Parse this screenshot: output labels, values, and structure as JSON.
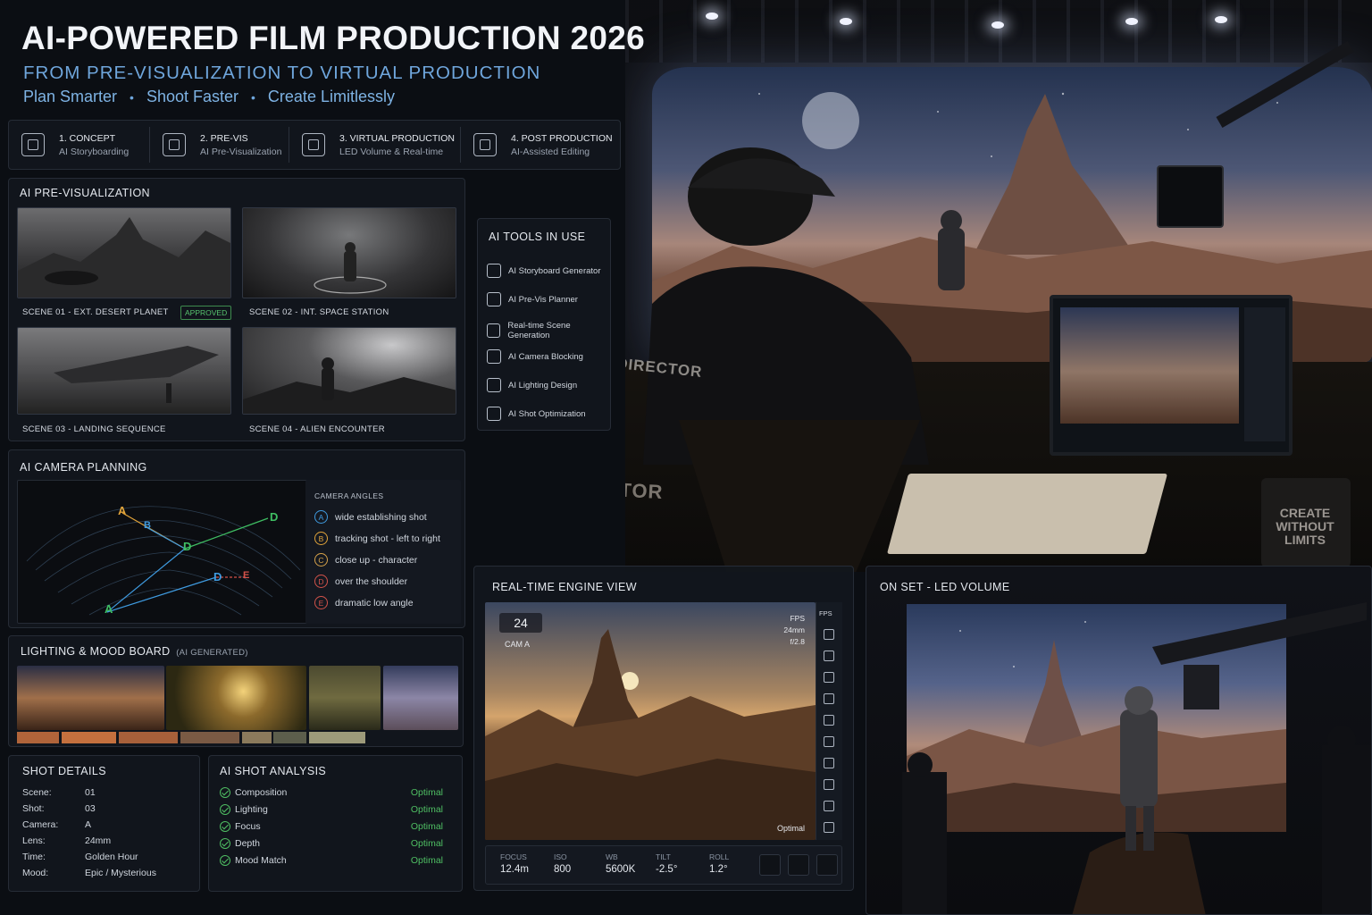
{
  "header": {
    "title": "AI-POWERED FILM PRODUCTION 2026",
    "subtitle": "FROM PRE-VISUALIZATION TO VIRTUAL PRODUCTION",
    "taglines": [
      "Plan Smarter",
      "Shoot Faster",
      "Create Limitlessly"
    ]
  },
  "workflow": [
    {
      "title": "1. CONCEPT",
      "desc": "AI Storyboarding",
      "icon": "storyboard-icon"
    },
    {
      "title": "2. PRE-VIS",
      "desc": "AI Pre-Visualization",
      "icon": "previs-icon"
    },
    {
      "title": "3. VIRTUAL PRODUCTION",
      "desc": "LED Volume & Real-time",
      "icon": "camera-icon"
    },
    {
      "title": "4. POST PRODUCTION",
      "desc": "AI-Assisted Editing",
      "icon": "edit-icon"
    }
  ],
  "previs": {
    "title": "AI PRE-VISUALIZATION",
    "scenes": [
      {
        "label": "SCENE 01 - EXT. DESERT PLANET",
        "status": "APPROVED"
      },
      {
        "label": "SCENE 02 - INT. SPACE STATION"
      },
      {
        "label": "SCENE 03 - LANDING SEQUENCE"
      },
      {
        "label": "SCENE 04 - ALIEN ENCOUNTER"
      }
    ]
  },
  "tools": {
    "title": "AI TOOLS IN USE",
    "items": [
      {
        "label": "AI Storyboard Generator",
        "icon": "storyboard-icon"
      },
      {
        "label": "AI Pre-Vis Planner",
        "icon": "planner-icon"
      },
      {
        "label": "Real-time Scene Generation",
        "icon": "scene-gen-icon"
      },
      {
        "label": "AI Camera Blocking",
        "icon": "camera-blocking-icon"
      },
      {
        "label": "AI Lighting Design",
        "icon": "lightbulb-icon"
      },
      {
        "label": "AI Shot Optimization",
        "icon": "optimize-icon"
      }
    ]
  },
  "camera_planning": {
    "title": "AI CAMERA PLANNING",
    "angles_title": "CAMERA ANGLES",
    "angles": [
      {
        "letter": "A",
        "label": "wide establishing shot",
        "color": "#3f9be0"
      },
      {
        "letter": "B",
        "label": "tracking shot - left to right",
        "color": "#e0a33a"
      },
      {
        "letter": "C",
        "label": "close up - character",
        "color": "#d6a24a"
      },
      {
        "letter": "D",
        "label": "over the shoulder",
        "color": "#d2524a"
      },
      {
        "letter": "E",
        "label": "dramatic low angle",
        "color": "#d2524a"
      }
    ],
    "map_markers": [
      "A",
      "B",
      "D",
      "D",
      "A",
      "D",
      "E"
    ]
  },
  "lighting": {
    "title": "LIGHTING & MOOD BOARD",
    "note": "(AI GENERATED)",
    "swatches": [
      "#b0643a",
      "#c4703e",
      "#a7603a",
      "#7a5a44",
      "#8b7a5c",
      "#5c5e4c",
      "#9d9a7a"
    ]
  },
  "shot_details": {
    "title": "SHOT DETAILS",
    "rows": [
      {
        "key": "Scene:",
        "value": "01"
      },
      {
        "key": "Shot:",
        "value": "03"
      },
      {
        "key": "Camera:",
        "value": "A"
      },
      {
        "key": "Lens:",
        "value": "24mm"
      },
      {
        "key": "Time:",
        "value": "Golden Hour"
      },
      {
        "key": "Mood:",
        "value": "Epic / Mysterious"
      }
    ]
  },
  "analysis": {
    "title": "AI SHOT ANALYSIS",
    "rows": [
      {
        "label": "Composition",
        "value": "Optimal"
      },
      {
        "label": "Lighting",
        "value": "Optimal"
      },
      {
        "label": "Focus",
        "value": "Optimal"
      },
      {
        "label": "Depth",
        "value": "Optimal"
      },
      {
        "label": "Mood Match",
        "value": "Optimal"
      }
    ]
  },
  "engine": {
    "title": "REAL-TIME ENGINE VIEW",
    "fps_value": "24",
    "cam_label": "CAM A",
    "fps_label": "FPS",
    "lens": "24mm",
    "aperture": "f/2.8",
    "side_label": "FPS",
    "status_text": "Optimal",
    "readouts": [
      {
        "key": "FOCUS",
        "value": "12.4m"
      },
      {
        "key": "ISO",
        "value": "800"
      },
      {
        "key": "WB",
        "value": "5600K"
      },
      {
        "key": "TILT",
        "value": "-2.5°"
      },
      {
        "key": "ROLL",
        "value": "1.2°"
      }
    ]
  },
  "onset": {
    "title": "ON SET - LED VOLUME"
  },
  "studio": {
    "chair_label": "DIRECTOR",
    "jacket_label": "DIRECTOR",
    "mug_text": "CREATE WITHOUT LIMITS"
  }
}
